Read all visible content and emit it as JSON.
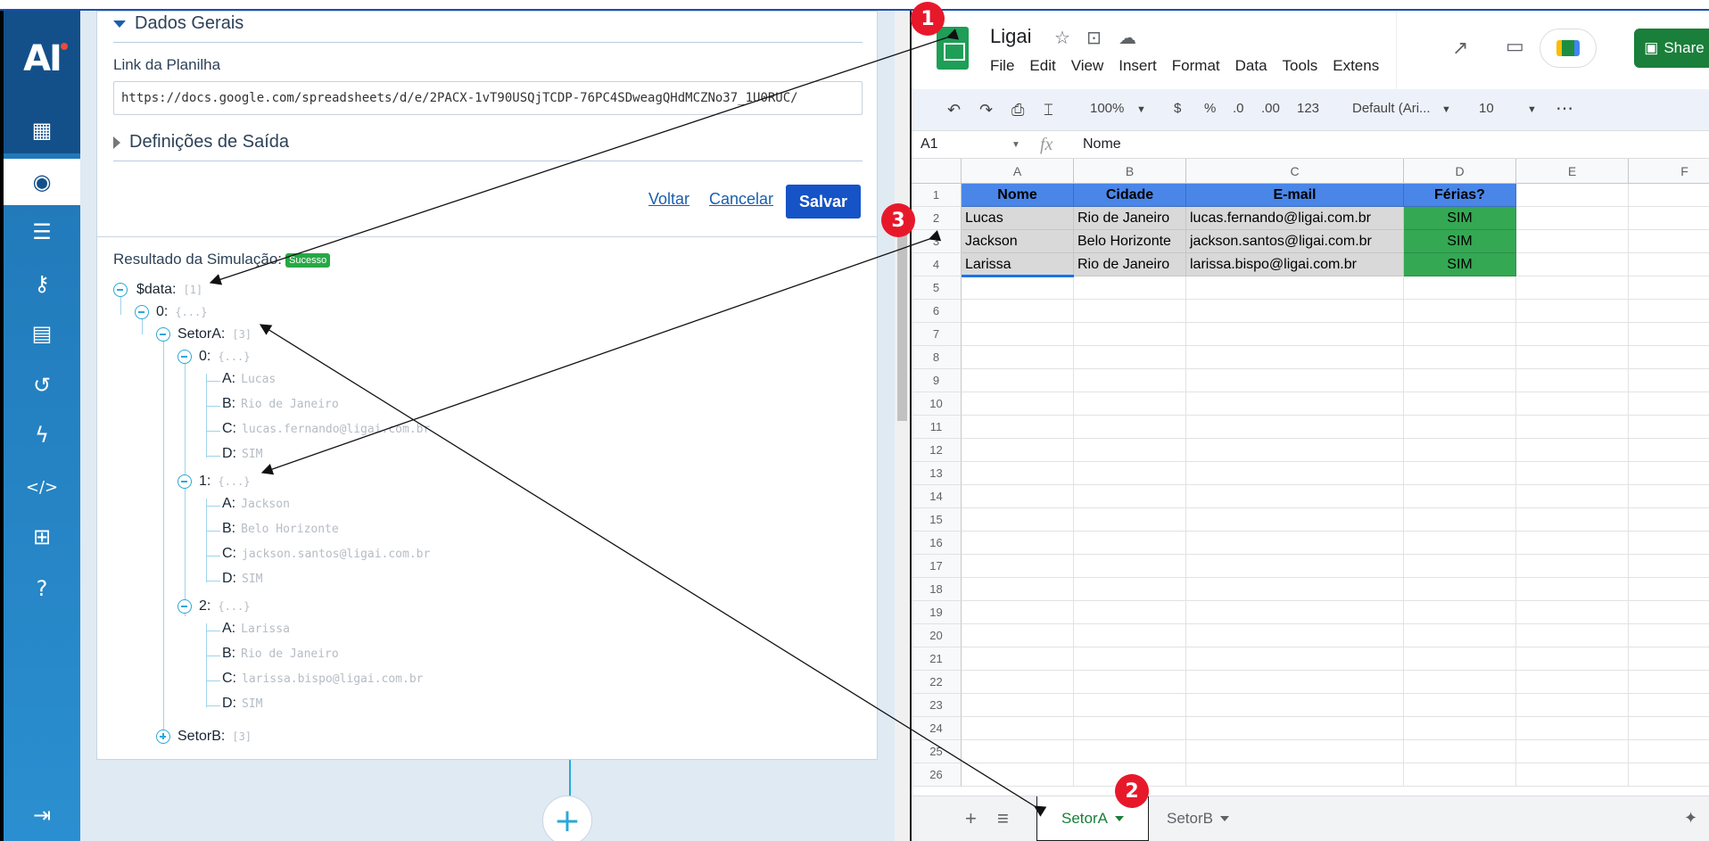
{
  "sidebar": {
    "logo": "AI",
    "items": [
      {
        "icon": "building-icon",
        "glyph": "▦"
      },
      {
        "icon": "robot-icon",
        "glyph": "◉"
      },
      {
        "icon": "sliders-icon",
        "glyph": "☰"
      },
      {
        "icon": "key-icon",
        "glyph": "⚷"
      },
      {
        "icon": "invoice-icon",
        "glyph": "▤"
      },
      {
        "icon": "history-icon",
        "glyph": "↺"
      },
      {
        "icon": "lightning-icon",
        "glyph": "ϟ"
      },
      {
        "icon": "code-icon",
        "glyph": "</>"
      },
      {
        "icon": "sitemap-icon",
        "glyph": "⊞"
      },
      {
        "icon": "help-icon",
        "glyph": "?"
      },
      {
        "icon": "logout-icon",
        "glyph": "⇥"
      }
    ]
  },
  "form": {
    "section_general": "Dados Gerais",
    "link_label": "Link da Planilha",
    "link_value": "https://docs.google.com/spreadsheets/d/e/2PACX-1vT90USQjTCDP-76PC4SDweagQHdMCZNo37_1U0RUC/",
    "section_output": "Definições de Saída",
    "back_label": "Voltar",
    "cancel_label": "Cancelar",
    "save_label": "Salvar"
  },
  "simulation": {
    "label": "Resultado da Simulação:",
    "status": "Sucesso",
    "root_key": "$data:",
    "root_meta": "[1]",
    "item0_key": "0:",
    "item0_meta": "{...}",
    "setorA_key": "SetorA:",
    "setorA_meta": "[3]",
    "setorB_key": "SetorB:",
    "setorB_meta": "[3]",
    "records": [
      {
        "key": "0:",
        "meta": "{...}",
        "A": "Lucas",
        "B": "Rio de Janeiro",
        "C": "lucas.fernando@ligai.com.br",
        "D": "SIM"
      },
      {
        "key": "1:",
        "meta": "{...}",
        "A": "Jackson",
        "B": "Belo Horizonte",
        "C": "jackson.santos@ligai.com.br",
        "D": "SIM"
      },
      {
        "key": "2:",
        "meta": "{...}",
        "A": "Larissa",
        "B": "Rio de Janeiro",
        "C": "larissa.bispo@ligai.com.br",
        "D": "SIM"
      }
    ],
    "field_labels": {
      "A": "A:",
      "B": "B:",
      "C": "C:",
      "D": "D:"
    }
  },
  "sheets": {
    "title": "Ligai",
    "menu": [
      "File",
      "Edit",
      "View",
      "Insert",
      "Format",
      "Data",
      "Tools",
      "Extens"
    ],
    "share_label": "Share",
    "toolbar": {
      "zoom": "100%",
      "currency": "$",
      "percent": "%",
      "dec_less": ".0",
      "dec_more": ".00",
      "format_num": "123",
      "font": "Default (Ari...",
      "font_size": "10",
      "more": "⋯"
    },
    "name_box": "A1",
    "fx": "fx",
    "formula": "Nome",
    "columns": [
      "A",
      "B",
      "C",
      "D",
      "E",
      "F"
    ],
    "header_row": [
      "Nome",
      "Cidade",
      "E-mail",
      "Férias?"
    ],
    "rows": [
      [
        "Lucas",
        "Rio de Janeiro",
        "lucas.fernando@ligai.com.br",
        "SIM"
      ],
      [
        "Jackson",
        "Belo Horizonte",
        "jackson.santos@ligai.com.br",
        "SIM"
      ],
      [
        "Larissa",
        "Rio de Janeiro",
        "larissa.bispo@ligai.com.br",
        "SIM"
      ]
    ],
    "row_numbers": [
      "1",
      "2",
      "3",
      "4",
      "5",
      "6",
      "7",
      "8",
      "9",
      "10",
      "11",
      "12",
      "13",
      "14",
      "15",
      "16",
      "17",
      "18",
      "19",
      "20",
      "21",
      "22",
      "23",
      "24",
      "25",
      "26"
    ],
    "tabs": [
      {
        "label": "SetorA",
        "active": true
      },
      {
        "label": "SetorB",
        "active": false
      }
    ],
    "add_sheet": "+",
    "all_sheets": "≡"
  },
  "annotations": {
    "m1": "1",
    "m2": "2",
    "m3": "3"
  },
  "colors": {
    "header_blue": "#4a86e8",
    "vacation_green": "#34a853",
    "save_blue": "#1553c7",
    "sidebar_blue": "#1f74b4",
    "marker_red": "#e8182b"
  }
}
